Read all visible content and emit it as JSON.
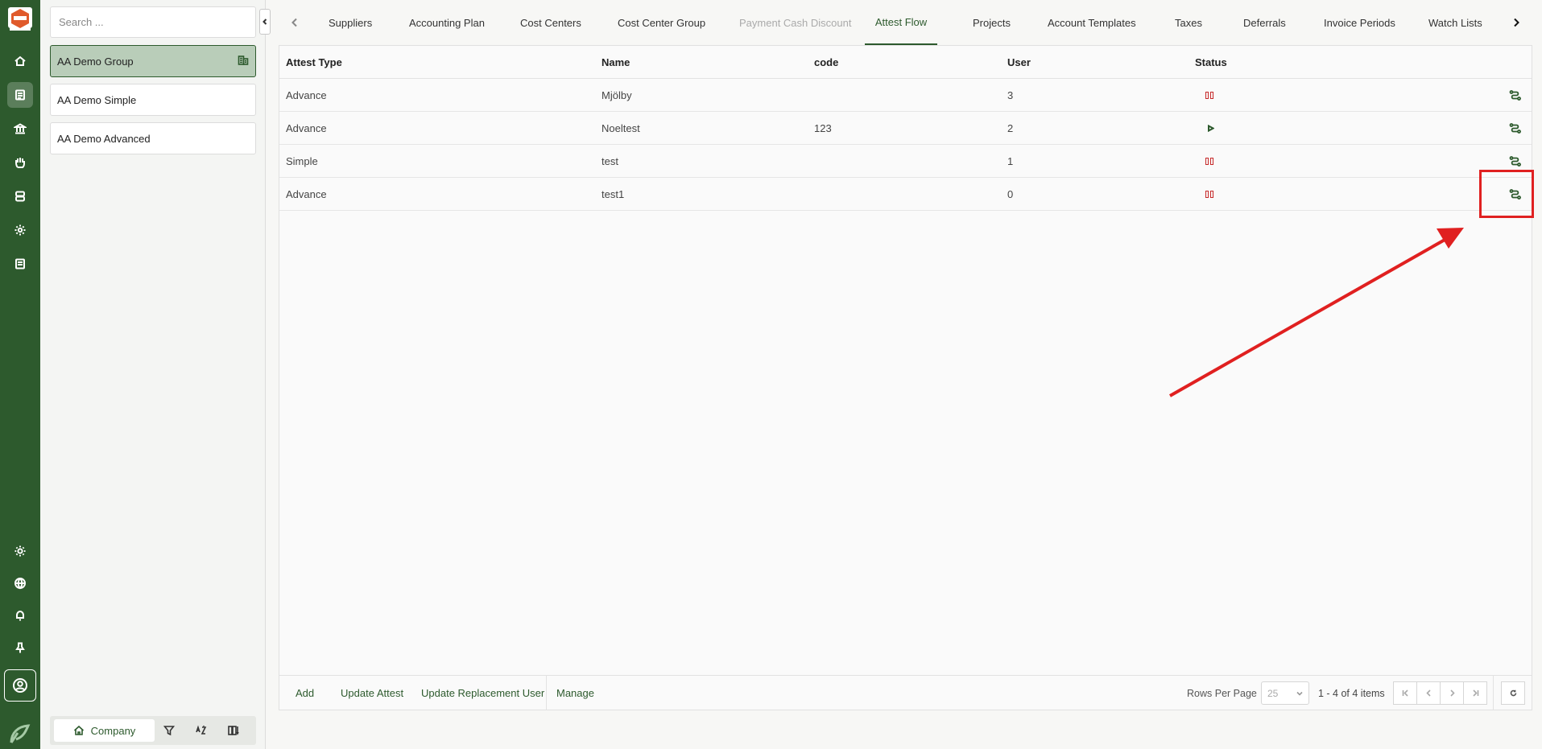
{
  "sidebar": {
    "rail_items": [
      "home-icon",
      "list-icon",
      "bank-icon",
      "hand-icon",
      "database-icon",
      "settings-icon",
      "document-icon"
    ],
    "bottom_items": [
      "sun-icon",
      "globe-icon",
      "bell-icon",
      "pin-icon",
      "user-circle-icon"
    ],
    "active_item": "list-icon"
  },
  "company_panel": {
    "search_placeholder": "Search ...",
    "companies": [
      {
        "name": "AA Demo Group",
        "selected": true
      },
      {
        "name": "AA Demo Simple",
        "selected": false
      },
      {
        "name": "AA Demo Advanced",
        "selected": false
      }
    ],
    "footer_company_label": "Company"
  },
  "tabs": [
    {
      "label": "Suppliers",
      "state": "normal"
    },
    {
      "label": "Accounting Plan",
      "state": "normal"
    },
    {
      "label": "Cost Centers",
      "state": "normal"
    },
    {
      "label": "Cost Center Group",
      "state": "normal"
    },
    {
      "label": "Payment Cash Discount",
      "state": "disabled"
    },
    {
      "label": "Attest Flow",
      "state": "active"
    },
    {
      "label": "Projects",
      "state": "normal"
    },
    {
      "label": "Account Templates",
      "state": "normal"
    },
    {
      "label": "Taxes",
      "state": "normal"
    },
    {
      "label": "Deferrals",
      "state": "normal"
    },
    {
      "label": "Invoice Periods",
      "state": "normal"
    },
    {
      "label": "Watch Lists",
      "state": "normal"
    }
  ],
  "grid": {
    "columns": [
      "Attest Type",
      "Name",
      "code",
      "User",
      "Status"
    ],
    "rows": [
      {
        "attest_type": "Advance",
        "name": "Mjölby",
        "code": "",
        "user": "3",
        "status": "paused"
      },
      {
        "attest_type": "Advance",
        "name": "Noeltest",
        "code": "123",
        "user": "2",
        "status": "active"
      },
      {
        "attest_type": "Simple",
        "name": "test",
        "code": "",
        "user": "1",
        "status": "paused"
      },
      {
        "attest_type": "Advance",
        "name": "test1",
        "code": "",
        "user": "0",
        "status": "paused"
      }
    ]
  },
  "footer": {
    "buttons": [
      "Add",
      "Update Attest",
      "Update Replacement User",
      "Manage"
    ],
    "rows_per_page_label": "Rows Per Page",
    "rows_per_page_value": "25",
    "range_text": "1 - 4 of 4 items"
  },
  "colors": {
    "brand_green": "#2d5a2d",
    "selected_company": "#b9cdb9",
    "paused_red": "#c62828",
    "annotation_red": "#e02020"
  }
}
